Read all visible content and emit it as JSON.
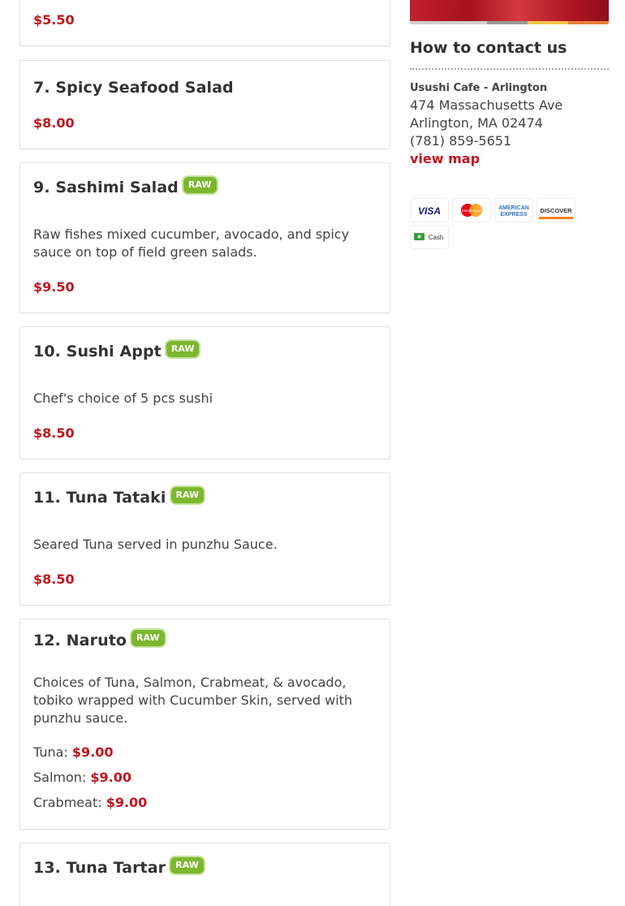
{
  "menu": {
    "top_price": "$5.50",
    "items": [
      {
        "title": "7. Spicy Seafood Salad",
        "raw": false,
        "description": "",
        "price": "$8.00"
      },
      {
        "title": "9. Sashimi Salad",
        "raw": true,
        "description": "Raw fishes mixed cucumber, avocado, and spicy sauce on top of field green salads.",
        "price": "$9.50"
      },
      {
        "title": "10. Sushi Appt",
        "raw": true,
        "description": "Chef's choice of 5 pcs sushi",
        "price": "$8.50"
      },
      {
        "title": "11. Tuna Tataki",
        "raw": true,
        "description": "Seared Tuna served in punzhu Sauce.",
        "price": "$8.50"
      },
      {
        "title": "12. Naruto",
        "raw": true,
        "description": "Choices of Tuna, Salmon, Crabmeat, & avocado, tobiko wrapped with Cucumber Skin, served with punzhu sauce.",
        "options": [
          {
            "label": "Tuna:",
            "price": "$9.00"
          },
          {
            "label": "Salmon:",
            "price": "$9.00"
          },
          {
            "label": "Crabmeat:",
            "price": "$9.00"
          }
        ]
      },
      {
        "title": "13. Tuna Tartar",
        "raw": true
      }
    ],
    "raw_label": "RAW"
  },
  "contact": {
    "heading": "How to contact us",
    "location_name": "Usushi Cafe - Arlington",
    "address_line1": "474 Massachusetts Ave",
    "address_line2": "Arlington, MA 02474",
    "phone": "(781) 859-5651",
    "view_map": "view map"
  },
  "payments": {
    "visa": "VISA",
    "mastercard": "MasterCard",
    "amex_line1": "AMERICAN",
    "amex_line2": "EXPRESS",
    "discover": "DISCOVER",
    "cash": "Cash"
  },
  "colors": {
    "price_red": "#c0161d",
    "raw_green": "#7cb72e",
    "border": "#e1e1e1"
  }
}
